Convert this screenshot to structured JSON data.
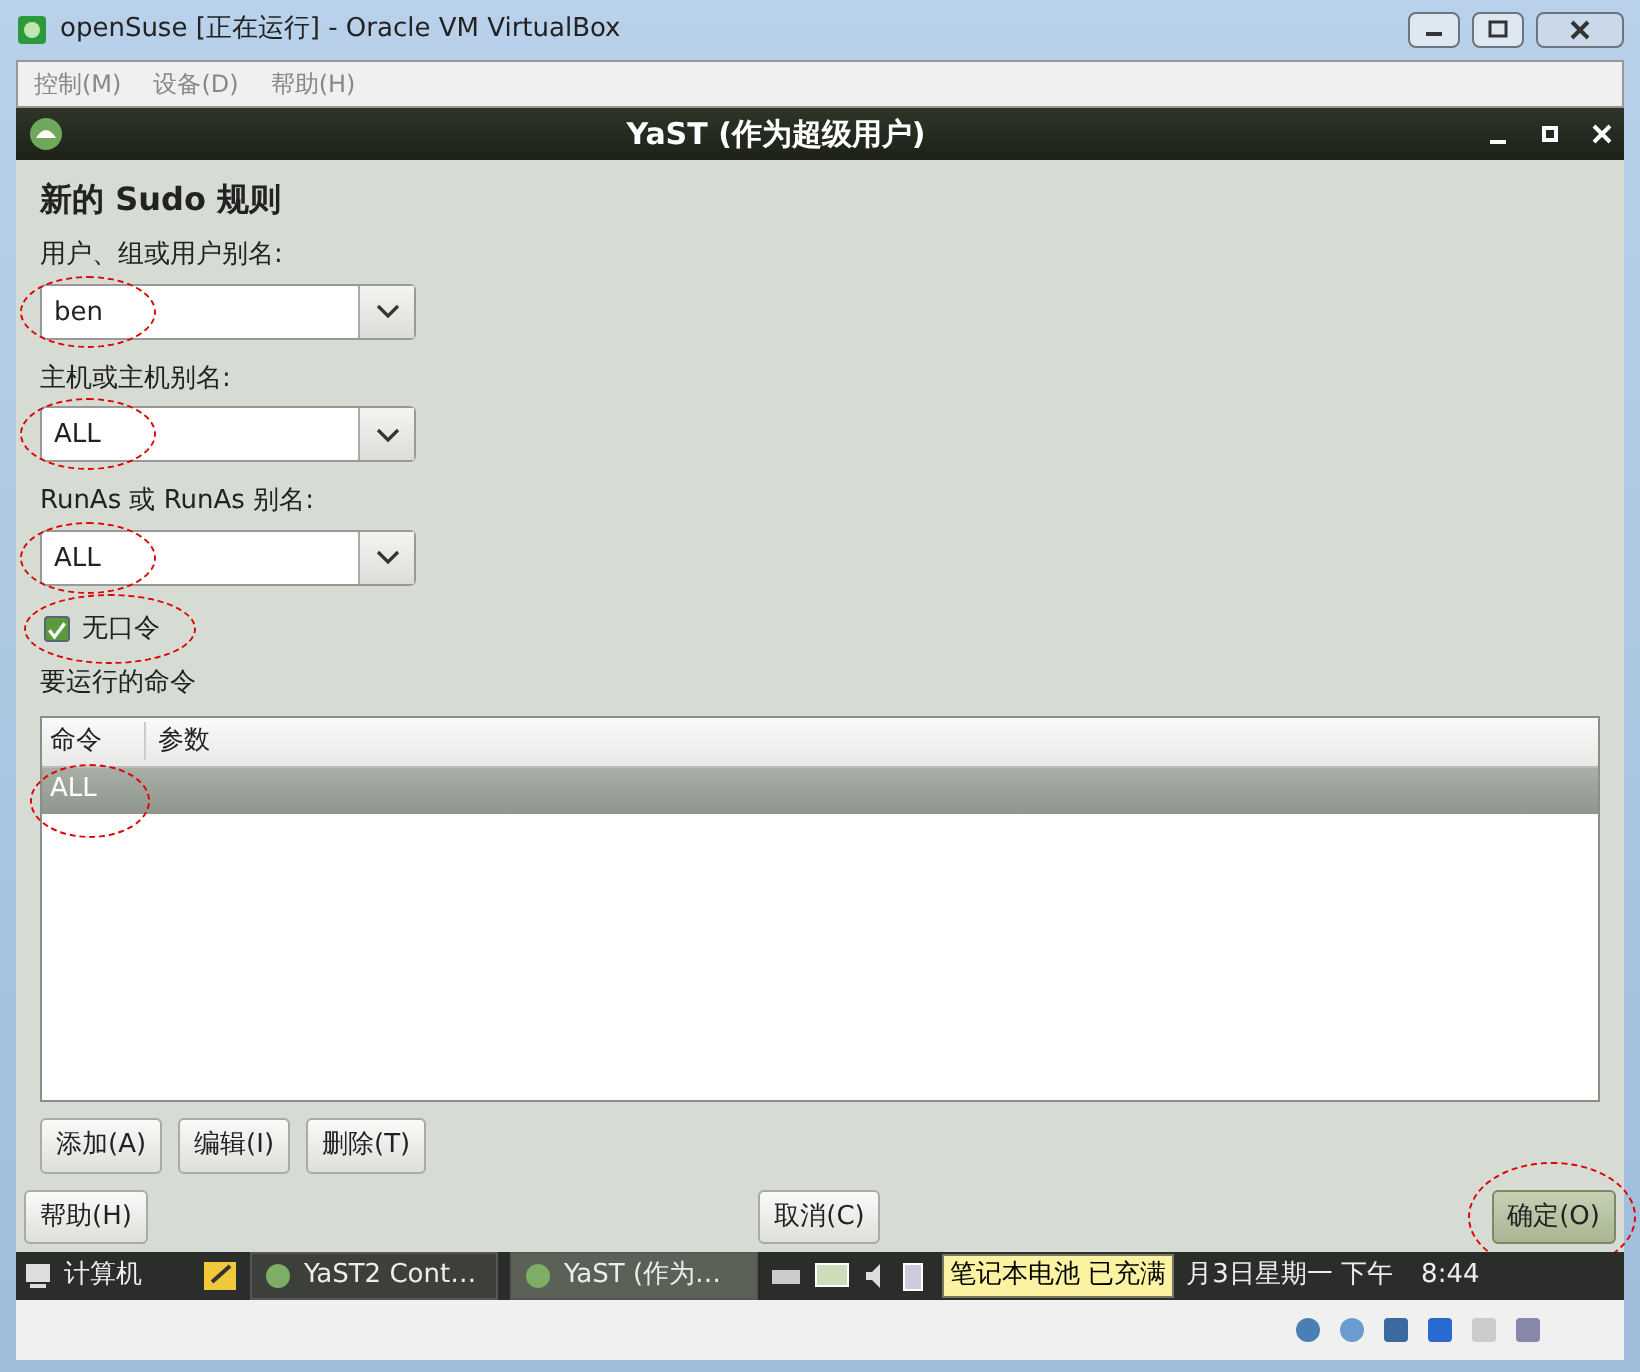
{
  "window": {
    "title": "openSuse [正在运行] - Oracle VM VirtualBox"
  },
  "menu": [
    "控制(M)",
    "设备(D)",
    "帮助(H)"
  ],
  "dialog": {
    "title": "YaST (作为超级用户)",
    "heading": "新的 Sudo 规则",
    "fields": [
      {
        "label": "用户、组或用户别名:",
        "value": "ben",
        "circled": true
      },
      {
        "label": "主机或主机别名:",
        "value": "ALL",
        "circled": true
      },
      {
        "label": "RunAs 或 RunAs 别名:",
        "value": "ALL",
        "circled": true
      }
    ],
    "checkbox": {
      "label": "无口令",
      "checked": true,
      "circled": true
    },
    "commands": {
      "label": "要运行的命令",
      "columns": [
        "命令",
        "参数"
      ],
      "rows": [
        {
          "command": "ALL",
          "selected": true,
          "circled": true
        }
      ]
    },
    "row_buttons": [
      "添加(A)",
      "编辑(I)",
      "删除(T)"
    ],
    "buttons": [
      {
        "label": "帮助(H)",
        "default": false,
        "circled": false
      },
      {
        "label": "取消(C)",
        "default": false,
        "circled": false
      },
      {
        "label": "确定(O)",
        "default": true,
        "circled": true
      }
    ]
  },
  "taskbar": {
    "start": "计算机",
    "tasks": [
      {
        "label": "YaST2 Cont…",
        "selected": false
      },
      {
        "label": "YaST (作为…",
        "selected": true
      }
    ],
    "date": "月3日星期一 下午",
    "time": "8:44",
    "tooltip": "笔记本电池 已充满"
  }
}
